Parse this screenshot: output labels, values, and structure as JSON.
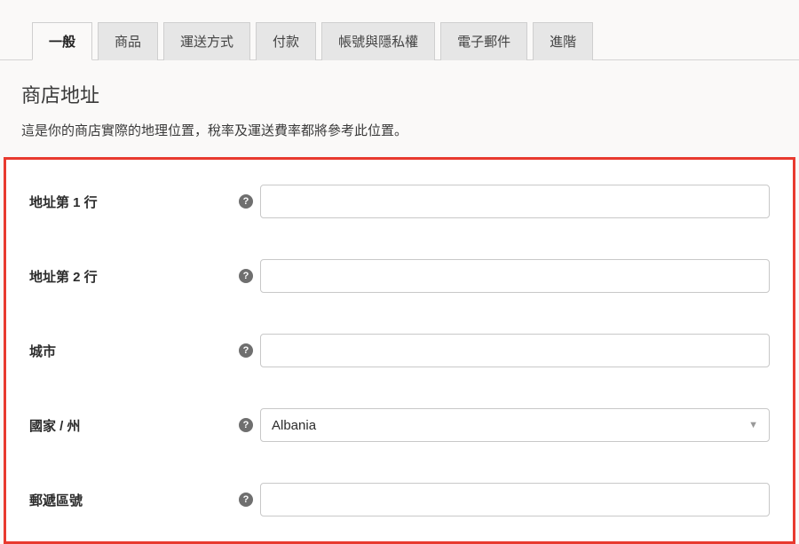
{
  "tabs": [
    {
      "label": "一般",
      "active": true
    },
    {
      "label": "商品",
      "active": false
    },
    {
      "label": "運送方式",
      "active": false
    },
    {
      "label": "付款",
      "active": false
    },
    {
      "label": "帳號與隱私權",
      "active": false
    },
    {
      "label": "電子郵件",
      "active": false
    },
    {
      "label": "進階",
      "active": false
    }
  ],
  "section": {
    "title": "商店地址",
    "description": "這是你的商店實際的地理位置，稅率及運送費率都將參考此位置。"
  },
  "fields": {
    "address1": {
      "label": "地址第 1 行",
      "value": ""
    },
    "address2": {
      "label": "地址第 2 行",
      "value": ""
    },
    "city": {
      "label": "城市",
      "value": ""
    },
    "country": {
      "label": "國家 / 州",
      "value": "Albania"
    },
    "postcode": {
      "label": "郵遞區號",
      "value": ""
    }
  },
  "help_glyph": "?"
}
